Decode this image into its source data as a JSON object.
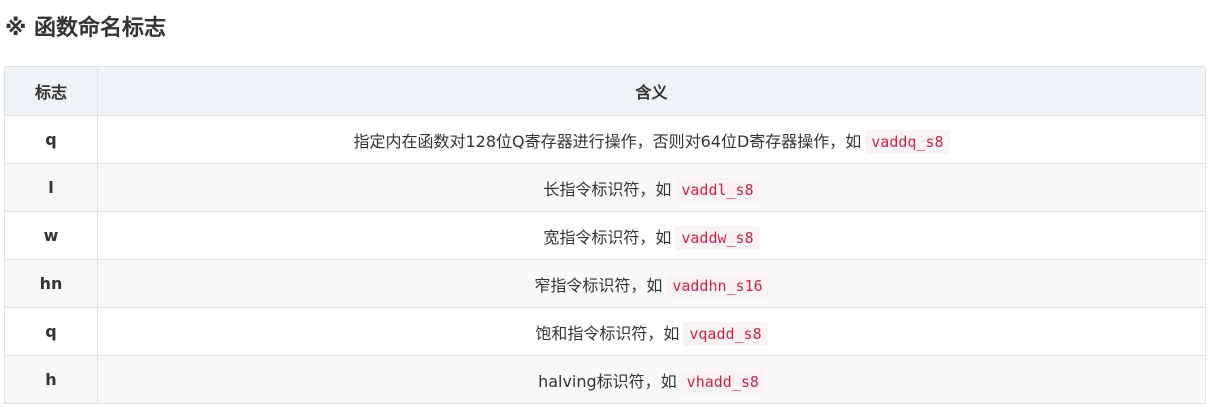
{
  "section": {
    "title": "※ 函数命名标志"
  },
  "table": {
    "headers": [
      "标志",
      "含义"
    ],
    "rows": [
      {
        "flag": "q",
        "meaning": "指定内在函数对128位Q寄存器进行操作，否则对64位D寄存器操作，如",
        "example": "vaddq_s8"
      },
      {
        "flag": "l",
        "meaning": "长指令标识符，如",
        "example": "vaddl_s8"
      },
      {
        "flag": "w",
        "meaning": "宽指令标识符，如",
        "example": "vaddw_s8"
      },
      {
        "flag": "hn",
        "meaning": "窄指令标识符，如",
        "example": "vaddhn_s16"
      },
      {
        "flag": "q",
        "meaning": "饱和指令标识符，如",
        "example": "vqadd_s8"
      },
      {
        "flag": "h",
        "meaning": "halving标识符，如",
        "example": "vhadd_s8"
      }
    ]
  }
}
